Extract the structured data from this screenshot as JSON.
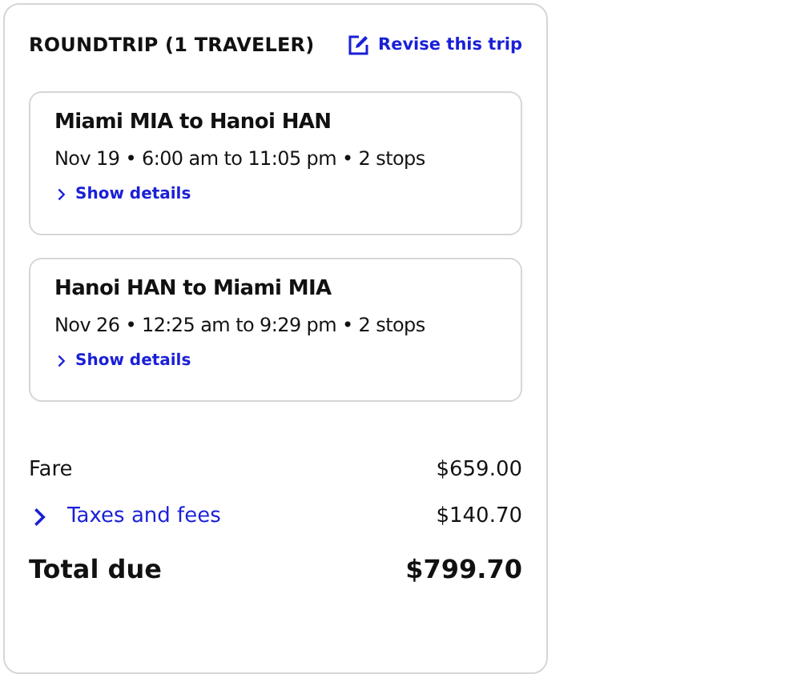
{
  "header": {
    "title": "ROUNDTRIP (1 TRAVELER)",
    "revise_link": "Revise this trip"
  },
  "flights": [
    {
      "route": "Miami MIA to Hanoi HAN",
      "details": "Nov 19 • 6:00 am to 11:05 pm • 2 stops",
      "toggle": "Show details"
    },
    {
      "route": "Hanoi HAN to Miami MIA",
      "details": "Nov 26 • 12:25 am to 9:29 pm • 2 stops",
      "toggle": "Show details"
    }
  ],
  "price_rows": [
    {
      "kind": "plain",
      "label": "Fare",
      "amount": "$659.00"
    },
    {
      "kind": "expandable",
      "label": "Taxes and fees",
      "amount": "$140.70"
    },
    {
      "kind": "total",
      "label": "Total due",
      "amount": "$799.70"
    }
  ]
}
